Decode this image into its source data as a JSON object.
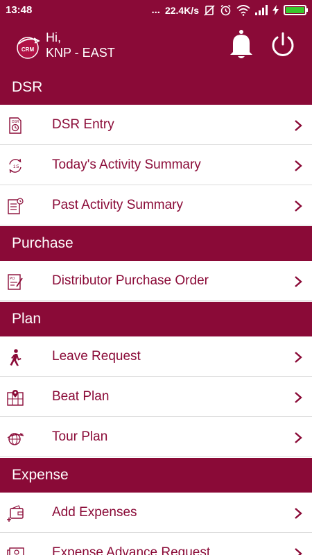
{
  "status_bar": {
    "time": "13:48",
    "dots": "...",
    "net_speed": "22.4K/s",
    "battery_level": 1.0,
    "battery_color": "#38c72b"
  },
  "header": {
    "logo_text": "CRM",
    "greeting": "Hi,",
    "user_name": "KNP - EAST",
    "background": "#8a0a37"
  },
  "sections": {
    "dsr": {
      "title": "DSR",
      "items": [
        {
          "label": "DSR Entry",
          "icon": "dsr-document-icon"
        },
        {
          "label": "Today's Activity Summary",
          "icon": "refresh-clock-icon"
        },
        {
          "label": "Past Activity Summary",
          "icon": "notepad-clock-icon"
        }
      ]
    },
    "purchase": {
      "title": "Purchase",
      "items": [
        {
          "label": "Distributor Purchase Order",
          "icon": "purchase-order-icon"
        }
      ]
    },
    "plan": {
      "title": "Plan",
      "items": [
        {
          "label": "Leave Request",
          "icon": "walking-person-icon"
        },
        {
          "label": "Beat Plan",
          "icon": "map-pin-icon"
        },
        {
          "label": "Tour Plan",
          "icon": "globe-plane-icon"
        }
      ]
    },
    "expense": {
      "title": "Expense",
      "items": [
        {
          "label": "Add Expenses",
          "icon": "wallet-add-icon"
        },
        {
          "label": "Expense Advance Request",
          "icon": "money-icon"
        }
      ]
    }
  },
  "accent_color": "#8a0a37"
}
